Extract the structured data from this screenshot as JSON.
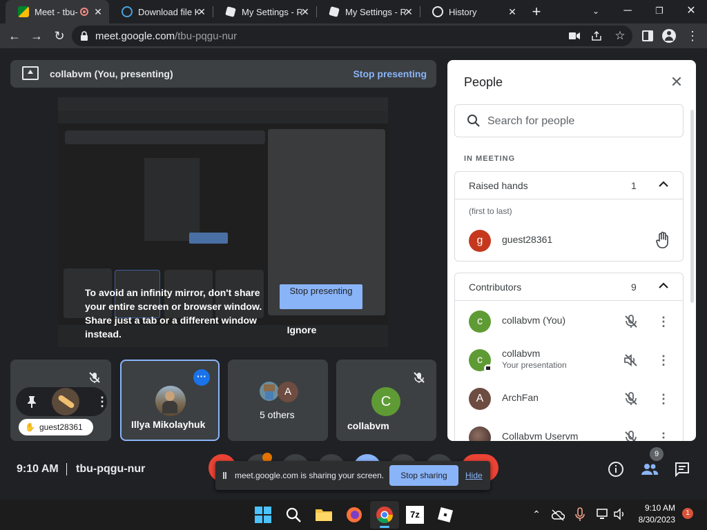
{
  "browser": {
    "tabs": [
      {
        "title": "Meet - tbu-",
        "active": true
      },
      {
        "title": "Download file K",
        "active": false
      },
      {
        "title": "My Settings - Re",
        "active": false
      },
      {
        "title": "My Settings - Re",
        "active": false
      },
      {
        "title": "History",
        "active": false
      }
    ],
    "url_host": "meet.google.com",
    "url_path": "/tbu-pqgu-nur"
  },
  "presenting_bar": {
    "label": "collabvm (You, presenting)",
    "stop_label": "Stop presenting"
  },
  "infinity_warning": {
    "text": "To avoid an infinity mirror, don't share your entire screen or browser window. Share just a tab or a different window instead.",
    "stop_presenting": "Stop presenting",
    "ignore": "Ignore"
  },
  "tiles": [
    {
      "name": "guest28361",
      "kind": "self"
    },
    {
      "name": "Illya Mikolayhuk",
      "kind": "active-speaker"
    },
    {
      "name": "5 others",
      "avatar_letter": "A"
    },
    {
      "name": "collabvm",
      "avatar_letter": "C"
    }
  ],
  "people_panel": {
    "title": "People",
    "search_placeholder": "Search for people",
    "section_label": "IN MEETING",
    "raised_hands": {
      "label": "Raised hands",
      "count": "1",
      "order_note": "(first to last)",
      "people": [
        {
          "initial": "g",
          "name": "guest28361",
          "color": "#c5381e"
        }
      ]
    },
    "contributors": {
      "label": "Contributors",
      "count": "9",
      "people": [
        {
          "initial": "c",
          "name": "collabvm (You)",
          "sub": "",
          "color": "#5f9b34"
        },
        {
          "initial": "c",
          "name": "collabvm",
          "sub": "Your presentation",
          "color": "#5f9b34"
        },
        {
          "initial": "A",
          "name": "ArchFan",
          "sub": "",
          "color": "#6d4c41"
        },
        {
          "initial": "",
          "name": "Collabvm Uservm",
          "sub": "",
          "color": "#4e342e"
        }
      ]
    }
  },
  "bottom_bar": {
    "time": "9:10 AM",
    "meeting_code": "tbu-pqgu-nur",
    "share_message": "meet.google.com is sharing your screen.",
    "stop_sharing": "Stop sharing",
    "hide": "Hide",
    "people_badge": "9"
  },
  "taskbar": {
    "time": "9:10 AM",
    "date": "8/30/2023",
    "notification_count": "1"
  },
  "colors": {
    "meet_bg": "#202124",
    "accent_blue": "#8ab4f8",
    "panel_bg": "#ffffff",
    "tile_bg": "#3c4043"
  }
}
